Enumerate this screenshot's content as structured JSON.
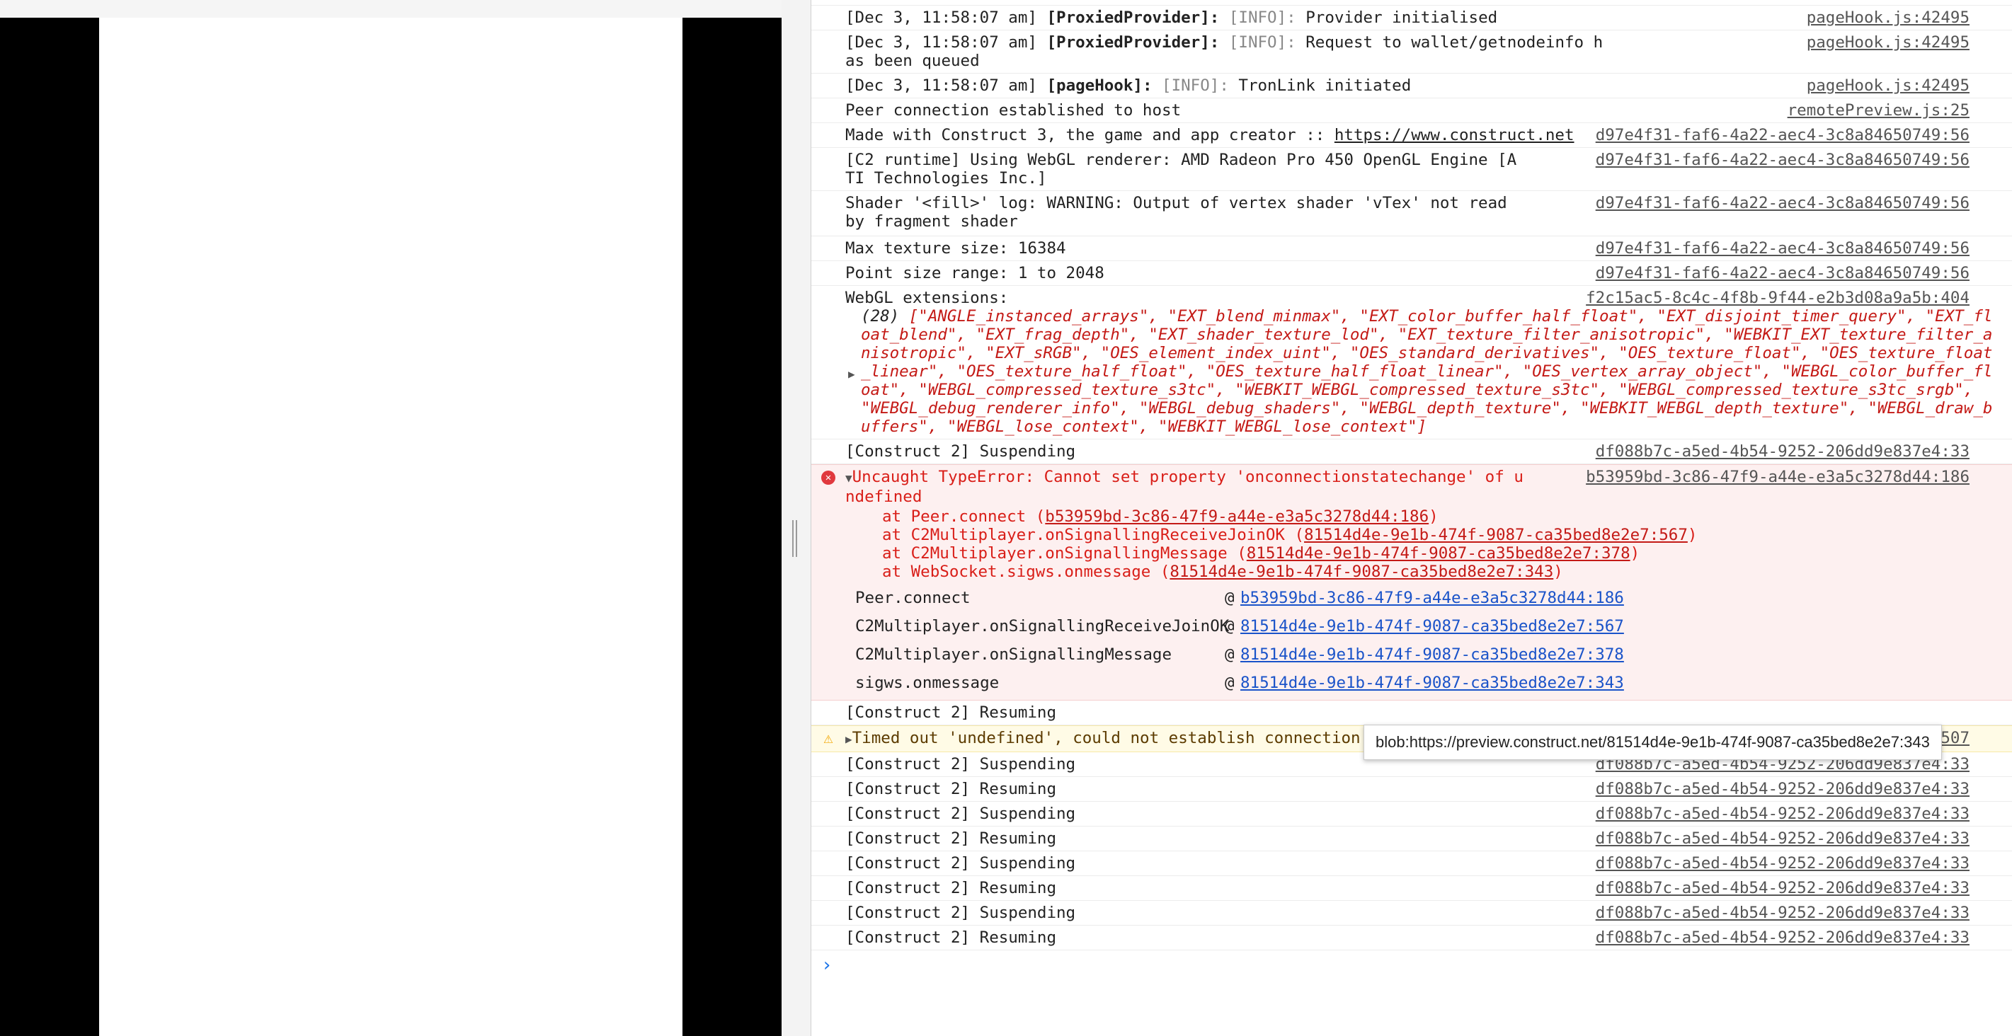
{
  "console": {
    "rows": [
      {
        "time": "[Dec 3, 11:58:07 am]",
        "tag": "[ProxiedProvider]:",
        "level": "[INFO]:",
        "text": "Provider initialised",
        "src": "pageHook.js:42495"
      },
      {
        "time": "[Dec 3, 11:58:07 am]",
        "tag": "[ProxiedProvider]:",
        "level": "[INFO]:",
        "text": "Request to wallet/getnodeinfo has been queued",
        "src": "pageHook.js:42495"
      },
      {
        "time": "[Dec 3, 11:58:07 am]",
        "tag": "[pageHook]:",
        "level": "[INFO]:",
        "text": "TronLink initiated",
        "src": "pageHook.js:42495"
      }
    ],
    "peer": {
      "text": "Peer connection established to host",
      "src": "remotePreview.js:25"
    },
    "made": {
      "text": "Made with Construct 3, the game and app creator :: ",
      "link": "https://www.construct.net",
      "src": "d97e4f31-faf6-4a22-aec4-3c8a84650749:56"
    },
    "webgl_renderer": {
      "text": "[C2 runtime] Using WebGL renderer: AMD Radeon Pro 450 OpenGL Engine [ATI Technologies Inc.]",
      "src": "d97e4f31-faf6-4a22-aec4-3c8a84650749:56"
    },
    "shader": {
      "text": "Shader '<fill>' log: WARNING: Output of vertex shader 'vTex' not read by fragment shader",
      "src": "d97e4f31-faf6-4a22-aec4-3c8a84650749:56"
    },
    "max_texture": {
      "text": "Max texture size: 16384",
      "src": "d97e4f31-faf6-4a22-aec4-3c8a84650749:56"
    },
    "point_size": {
      "text": "Point size range: 1 to 2048",
      "src": "d97e4f31-faf6-4a22-aec4-3c8a84650749:56"
    },
    "extensions": {
      "text": "WebGL extensions:",
      "src": "f2c15ac5-8c4c-4f8b-9f44-e2b3d08a9a5b:404",
      "count": "(28)",
      "list": "[\"ANGLE_instanced_arrays\", \"EXT_blend_minmax\", \"EXT_color_buffer_half_float\", \"EXT_disjoint_timer_query\", \"EXT_float_blend\", \"EXT_frag_depth\", \"EXT_shader_texture_lod\", \"EXT_texture_filter_anisotropic\", \"WEBKIT_EXT_texture_filter_anisotropic\", \"EXT_sRGB\", \"OES_element_index_uint\", \"OES_standard_derivatives\", \"OES_texture_float\", \"OES_texture_float_linear\", \"OES_texture_half_float\", \"OES_texture_half_float_linear\", \"OES_vertex_array_object\", \"WEBGL_color_buffer_float\", \"WEBGL_compressed_texture_s3tc\", \"WEBKIT_WEBGL_compressed_texture_s3tc\", \"WEBGL_compressed_texture_s3tc_srgb\", \"WEBGL_debug_renderer_info\", \"WEBGL_debug_shaders\", \"WEBGL_depth_texture\", \"WEBKIT_WEBGL_depth_texture\", \"WEBGL_draw_buffers\", \"WEBGL_lose_context\", \"WEBKIT_WEBGL_lose_context\"]"
    },
    "suspending1": {
      "text": "[Construct 2] Suspending",
      "src": "df088b7c-a5ed-4b54-9252-206dd9e837e4:33"
    },
    "error": {
      "title": "Uncaught TypeError: Cannot set property 'onconnectionstatechange' of undefined",
      "src": "b53959bd-3c86-47f9-a44e-e3a5c3278d44:186",
      "stack": [
        {
          "pre": "at Peer.connect (",
          "loc": "b53959bd-3c86-47f9-a44e-e3a5c3278d44:186"
        },
        {
          "pre": "at C2Multiplayer.onSignallingReceiveJoinOK (",
          "loc": "81514d4e-9e1b-474f-9087-ca35bed8e2e7:567"
        },
        {
          "pre": "at C2Multiplayer.onSignallingMessage (",
          "loc": "81514d4e-9e1b-474f-9087-ca35bed8e2e7:378"
        },
        {
          "pre": "at WebSocket.sigws.onmessage (",
          "loc": "81514d4e-9e1b-474f-9087-ca35bed8e2e7:343"
        }
      ],
      "frames": [
        {
          "fn": "Peer.connect",
          "link": "b53959bd-3c86-47f9-a44e-e3a5c3278d44:186"
        },
        {
          "fn": "C2Multiplayer.onSignallingReceiveJoinOK",
          "link": "81514d4e-9e1b-474f-9087-ca35bed8e2e7:567"
        },
        {
          "fn": "C2Multiplayer.onSignallingMessage",
          "link": "81514d4e-9e1b-474f-9087-ca35bed8e2e7:378"
        },
        {
          "fn": "sigws.onmessage",
          "link": "81514d4e-9e1b-474f-9087-ca35bed8e2e7:343"
        }
      ]
    },
    "resuming1": {
      "text": "[Construct 2] Resuming"
    },
    "tooltip": "blob:https://preview.construct.net/81514d4e-9e1b-474f-9087-ca35bed8e2e7:343",
    "warning": {
      "text": "Timed out 'undefined', could not establish connection after 25sec",
      "src": "b53959bd-3c86-47f9-a44e-e3a5c3278d44:507"
    },
    "tail": [
      {
        "text": "[Construct 2] Suspending",
        "src": "df088b7c-a5ed-4b54-9252-206dd9e837e4:33"
      },
      {
        "text": "[Construct 2] Resuming",
        "src": "df088b7c-a5ed-4b54-9252-206dd9e837e4:33"
      },
      {
        "text": "[Construct 2] Suspending",
        "src": "df088b7c-a5ed-4b54-9252-206dd9e837e4:33"
      },
      {
        "text": "[Construct 2] Resuming",
        "src": "df088b7c-a5ed-4b54-9252-206dd9e837e4:33"
      },
      {
        "text": "[Construct 2] Suspending",
        "src": "df088b7c-a5ed-4b54-9252-206dd9e837e4:33"
      },
      {
        "text": "[Construct 2] Resuming",
        "src": "df088b7c-a5ed-4b54-9252-206dd9e837e4:33"
      },
      {
        "text": "[Construct 2] Suspending",
        "src": "df088b7c-a5ed-4b54-9252-206dd9e837e4:33"
      },
      {
        "text": "[Construct 2] Resuming",
        "src": "df088b7c-a5ed-4b54-9252-206dd9e837e4:33"
      }
    ],
    "prompt_caret": "›"
  }
}
